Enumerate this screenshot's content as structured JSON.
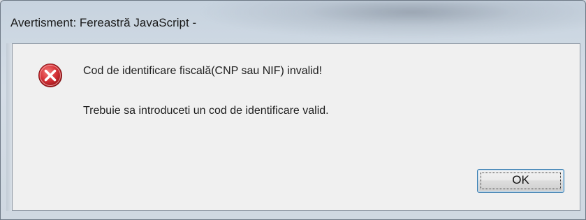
{
  "window": {
    "title": "Avertisment: Fereastră JavaScript -"
  },
  "dialog": {
    "icon": "error-icon",
    "message_primary": "Cod de identificare fiscală(CNP sau NIF) invalid!",
    "message_secondary": "Trebuie sa introduceti un cod de identificare valid.",
    "ok_label": "OK"
  },
  "colors": {
    "error_icon": "#c8252c",
    "button_focus_border": "#3c7fb1",
    "client_background": "#f0f0f0"
  }
}
